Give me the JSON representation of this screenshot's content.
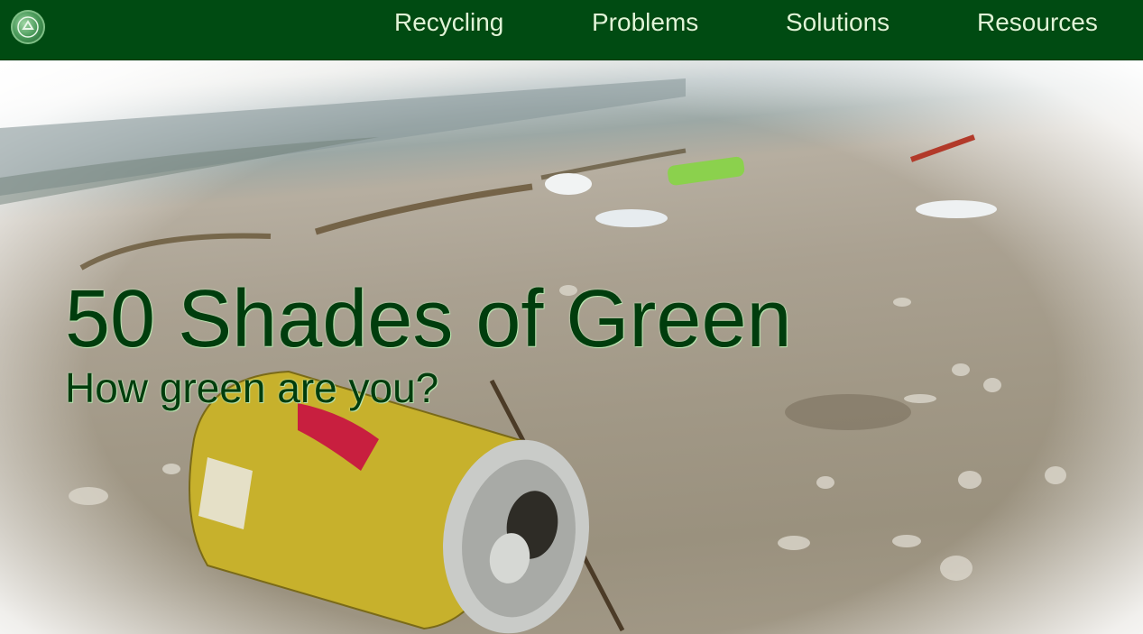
{
  "nav": {
    "logo_icon": "recycle-globe-icon",
    "links": [
      {
        "label": "Recycling"
      },
      {
        "label": "Problems"
      },
      {
        "label": "Solutions"
      },
      {
        "label": "Resources"
      }
    ]
  },
  "hero": {
    "title": "50 Shades of Green",
    "subtitle": "How green are you?",
    "image_subject": "beach-litter-photo"
  },
  "colors": {
    "nav_bg": "#004b12",
    "nav_text": "#dff5d6",
    "title_text": "#003d0d"
  }
}
